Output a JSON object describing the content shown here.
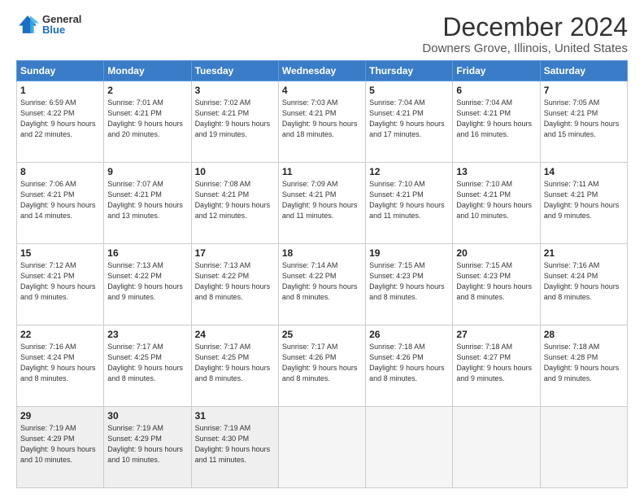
{
  "logo": {
    "general": "General",
    "blue": "Blue"
  },
  "title": "December 2024",
  "subtitle": "Downers Grove, Illinois, United States",
  "days_header": [
    "Sunday",
    "Monday",
    "Tuesday",
    "Wednesday",
    "Thursday",
    "Friday",
    "Saturday"
  ],
  "weeks": [
    [
      {
        "day": "1",
        "sunrise": "6:59 AM",
        "sunset": "4:22 PM",
        "daylight": "9 hours and 22 minutes."
      },
      {
        "day": "2",
        "sunrise": "7:01 AM",
        "sunset": "4:21 PM",
        "daylight": "9 hours and 20 minutes."
      },
      {
        "day": "3",
        "sunrise": "7:02 AM",
        "sunset": "4:21 PM",
        "daylight": "9 hours and 19 minutes."
      },
      {
        "day": "4",
        "sunrise": "7:03 AM",
        "sunset": "4:21 PM",
        "daylight": "9 hours and 18 minutes."
      },
      {
        "day": "5",
        "sunrise": "7:04 AM",
        "sunset": "4:21 PM",
        "daylight": "9 hours and 17 minutes."
      },
      {
        "day": "6",
        "sunrise": "7:04 AM",
        "sunset": "4:21 PM",
        "daylight": "9 hours and 16 minutes."
      },
      {
        "day": "7",
        "sunrise": "7:05 AM",
        "sunset": "4:21 PM",
        "daylight": "9 hours and 15 minutes."
      }
    ],
    [
      {
        "day": "8",
        "sunrise": "7:06 AM",
        "sunset": "4:21 PM",
        "daylight": "9 hours and 14 minutes."
      },
      {
        "day": "9",
        "sunrise": "7:07 AM",
        "sunset": "4:21 PM",
        "daylight": "9 hours and 13 minutes."
      },
      {
        "day": "10",
        "sunrise": "7:08 AM",
        "sunset": "4:21 PM",
        "daylight": "9 hours and 12 minutes."
      },
      {
        "day": "11",
        "sunrise": "7:09 AM",
        "sunset": "4:21 PM",
        "daylight": "9 hours and 11 minutes."
      },
      {
        "day": "12",
        "sunrise": "7:10 AM",
        "sunset": "4:21 PM",
        "daylight": "9 hours and 11 minutes."
      },
      {
        "day": "13",
        "sunrise": "7:10 AM",
        "sunset": "4:21 PM",
        "daylight": "9 hours and 10 minutes."
      },
      {
        "day": "14",
        "sunrise": "7:11 AM",
        "sunset": "4:21 PM",
        "daylight": "9 hours and 9 minutes."
      }
    ],
    [
      {
        "day": "15",
        "sunrise": "7:12 AM",
        "sunset": "4:21 PM",
        "daylight": "9 hours and 9 minutes."
      },
      {
        "day": "16",
        "sunrise": "7:13 AM",
        "sunset": "4:22 PM",
        "daylight": "9 hours and 9 minutes."
      },
      {
        "day": "17",
        "sunrise": "7:13 AM",
        "sunset": "4:22 PM",
        "daylight": "9 hours and 8 minutes."
      },
      {
        "day": "18",
        "sunrise": "7:14 AM",
        "sunset": "4:22 PM",
        "daylight": "9 hours and 8 minutes."
      },
      {
        "day": "19",
        "sunrise": "7:15 AM",
        "sunset": "4:23 PM",
        "daylight": "9 hours and 8 minutes."
      },
      {
        "day": "20",
        "sunrise": "7:15 AM",
        "sunset": "4:23 PM",
        "daylight": "9 hours and 8 minutes."
      },
      {
        "day": "21",
        "sunrise": "7:16 AM",
        "sunset": "4:24 PM",
        "daylight": "9 hours and 8 minutes."
      }
    ],
    [
      {
        "day": "22",
        "sunrise": "7:16 AM",
        "sunset": "4:24 PM",
        "daylight": "9 hours and 8 minutes."
      },
      {
        "day": "23",
        "sunrise": "7:17 AM",
        "sunset": "4:25 PM",
        "daylight": "9 hours and 8 minutes."
      },
      {
        "day": "24",
        "sunrise": "7:17 AM",
        "sunset": "4:25 PM",
        "daylight": "9 hours and 8 minutes."
      },
      {
        "day": "25",
        "sunrise": "7:17 AM",
        "sunset": "4:26 PM",
        "daylight": "9 hours and 8 minutes."
      },
      {
        "day": "26",
        "sunrise": "7:18 AM",
        "sunset": "4:26 PM",
        "daylight": "9 hours and 8 minutes."
      },
      {
        "day": "27",
        "sunrise": "7:18 AM",
        "sunset": "4:27 PM",
        "daylight": "9 hours and 9 minutes."
      },
      {
        "day": "28",
        "sunrise": "7:18 AM",
        "sunset": "4:28 PM",
        "daylight": "9 hours and 9 minutes."
      }
    ],
    [
      {
        "day": "29",
        "sunrise": "7:19 AM",
        "sunset": "4:29 PM",
        "daylight": "9 hours and 10 minutes."
      },
      {
        "day": "30",
        "sunrise": "7:19 AM",
        "sunset": "4:29 PM",
        "daylight": "9 hours and 10 minutes."
      },
      {
        "day": "31",
        "sunrise": "7:19 AM",
        "sunset": "4:30 PM",
        "daylight": "9 hours and 11 minutes."
      },
      {
        "day": "",
        "sunrise": "",
        "sunset": "",
        "daylight": ""
      },
      {
        "day": "",
        "sunrise": "",
        "sunset": "",
        "daylight": ""
      },
      {
        "day": "",
        "sunrise": "",
        "sunset": "",
        "daylight": ""
      },
      {
        "day": "",
        "sunrise": "",
        "sunset": "",
        "daylight": ""
      }
    ]
  ]
}
